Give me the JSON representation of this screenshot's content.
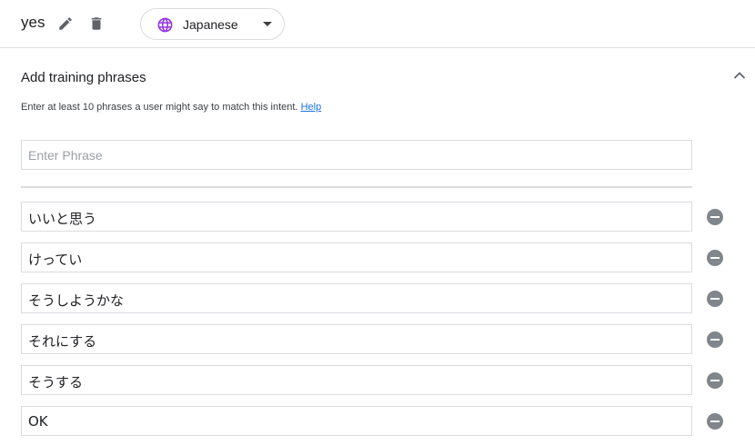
{
  "header": {
    "intent_name": "yes",
    "language": "Japanese",
    "icons": {
      "edit": "pencil-icon",
      "delete": "trash-icon",
      "language": "globe-icon",
      "dropdown": "caret-down-icon"
    },
    "globe_color": "#9334e6"
  },
  "training": {
    "title": "Add training phrases",
    "helper_text": "Enter at least 10 phrases a user might say to match this intent.",
    "help_link": "Help",
    "input_placeholder": "Enter Phrase",
    "phrases": [
      "いいと思う",
      "けってい",
      "そうしようかな",
      "それにする",
      "そうする",
      "OK"
    ]
  },
  "colors": {
    "link": "#1a73e8",
    "remove_button": "#80868b",
    "border": "#dadce0"
  }
}
